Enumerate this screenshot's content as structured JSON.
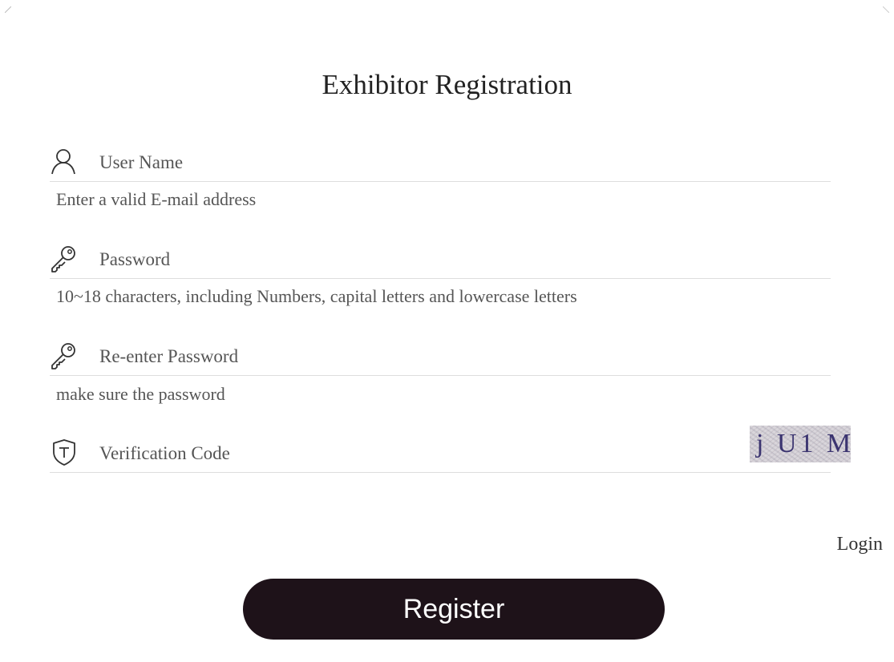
{
  "form": {
    "title": "Exhibitor Registration",
    "fields": [
      {
        "placeholder": "User Name",
        "icon": "user-icon",
        "hint": "Enter a valid E-mail address"
      },
      {
        "placeholder": "Password",
        "icon": "key-icon",
        "hint": "10~18 characters, including Numbers, capital letters and lowercase letters"
      },
      {
        "placeholder": "Re-enter Password",
        "icon": "key-icon",
        "hint": "make sure the password"
      },
      {
        "placeholder": "Verification Code",
        "icon": "shield-icon"
      }
    ],
    "captcha_text": "j U1 M",
    "login_label": "Login",
    "register_label": "Register"
  },
  "colors": {
    "button_bg": "#1e1219",
    "button_text": "#ffffff",
    "divider": "#dedede",
    "captcha_text": "#3b3470"
  }
}
